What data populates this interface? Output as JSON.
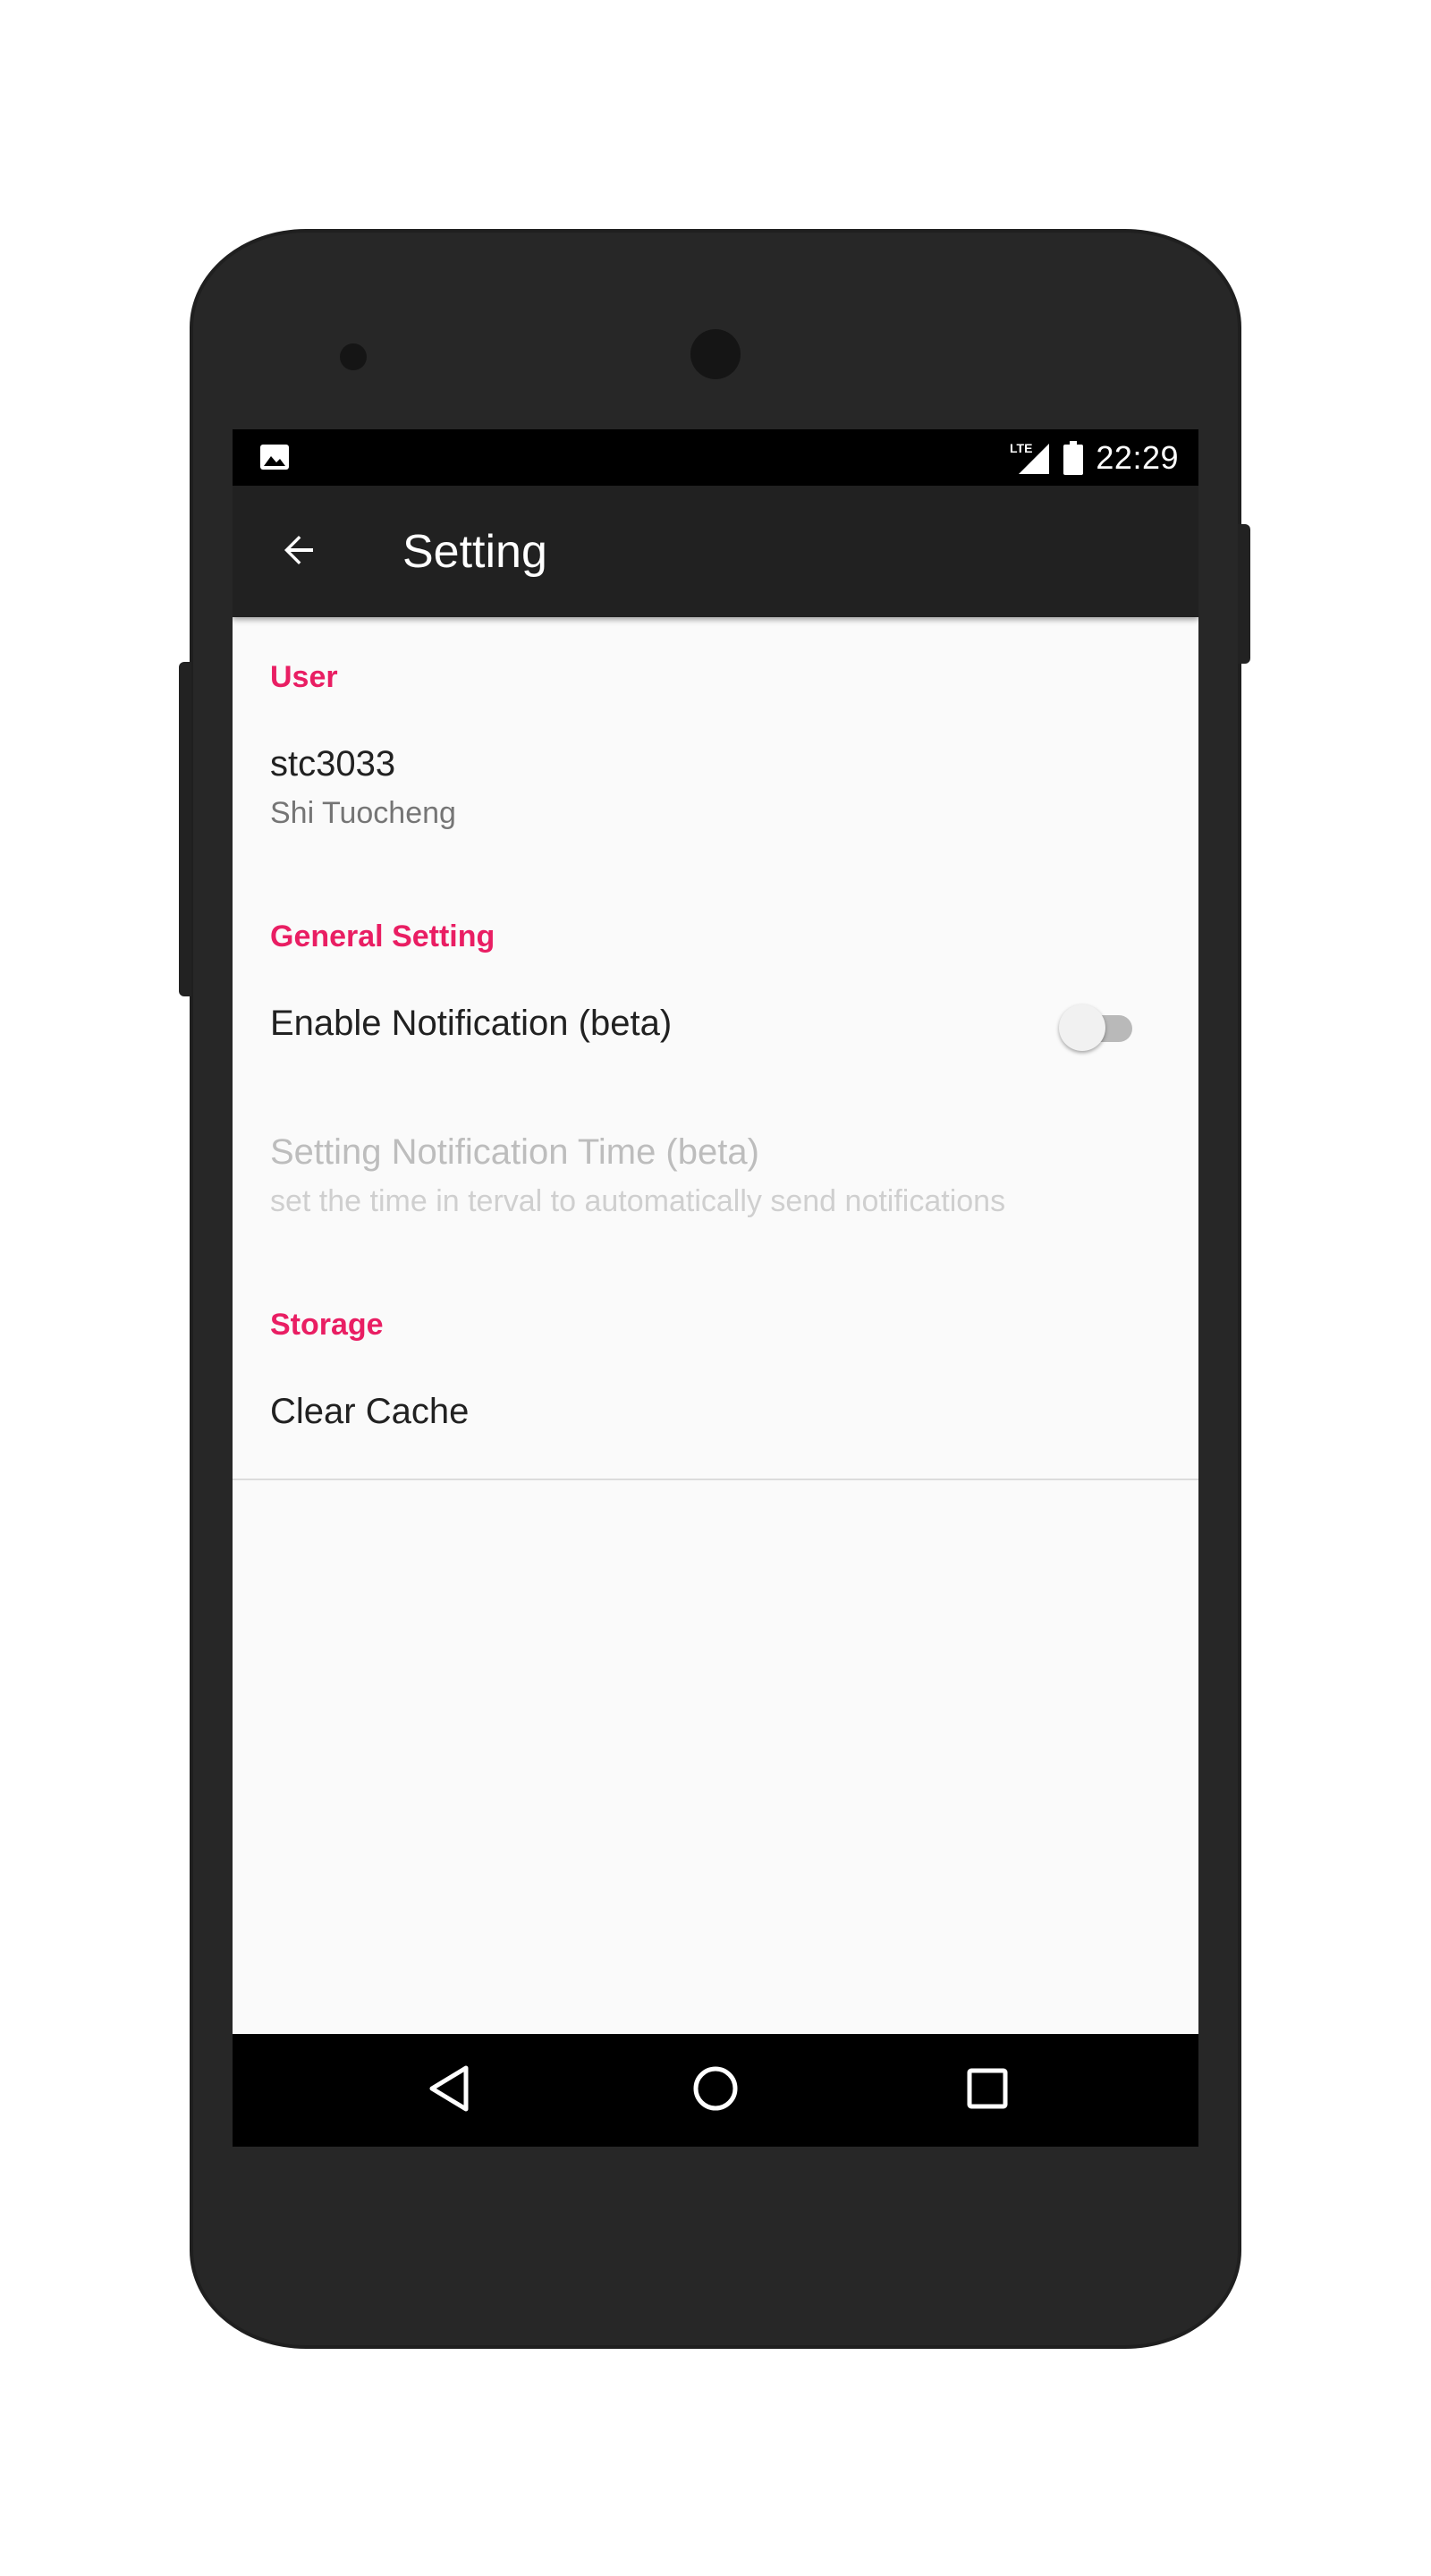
{
  "status_bar": {
    "time": "22:29",
    "left_icon": "image-notification-icon",
    "network": "LTE"
  },
  "app_bar": {
    "title": "Setting",
    "back_icon": "arrow-back-icon"
  },
  "sections": {
    "user": {
      "header": "User",
      "username": "stc3033",
      "full_name": "Shi Tuocheng"
    },
    "general": {
      "header": "General Setting",
      "notification_title": "Enable Notification (beta)",
      "notification_enabled": false,
      "time_title": "Setting Notification Time (beta)",
      "time_summary": "set the time in terval to automatically send notifications"
    },
    "storage": {
      "header": "Storage",
      "clear_cache": "Clear Cache"
    }
  },
  "nav_bar": {
    "back": "nav-back-icon",
    "home": "nav-home-icon",
    "recents": "nav-recents-icon"
  },
  "colors": {
    "accent": "#e91e63",
    "app_bar": "#212121",
    "background": "#fafafa"
  }
}
